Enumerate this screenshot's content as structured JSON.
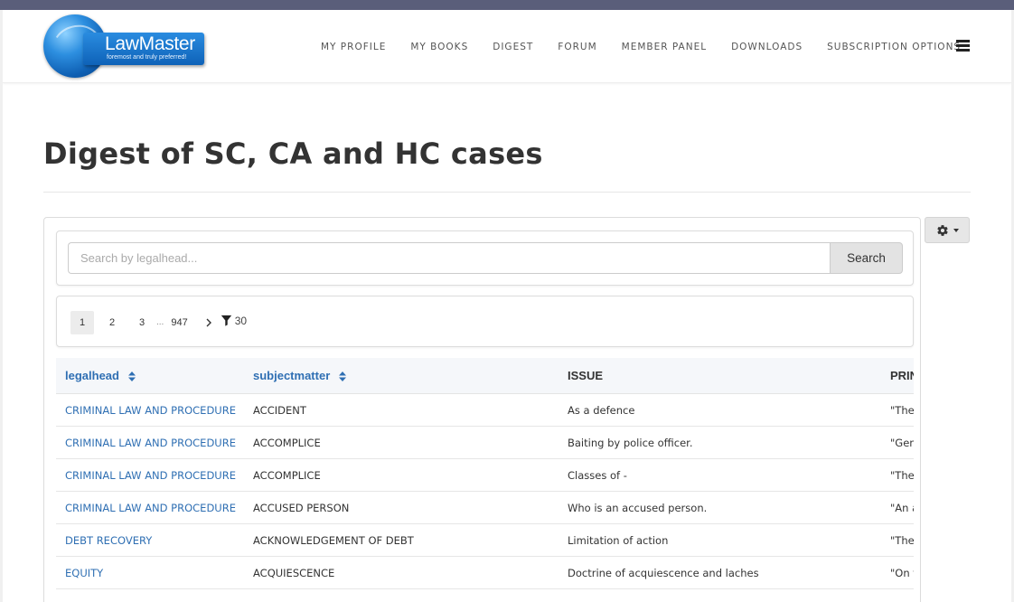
{
  "header": {
    "logo_title": "LawMaster",
    "logo_tagline": "foremost and truly preferred!",
    "nav": [
      {
        "label": "MY PROFILE"
      },
      {
        "label": "MY BOOKS"
      },
      {
        "label": "DIGEST"
      },
      {
        "label": "FORUM"
      },
      {
        "label": "MEMBER PANEL"
      },
      {
        "label": "DOWNLOADS"
      },
      {
        "label": "SUBSCRIPTION OPTIONS"
      }
    ],
    "menu_icon": "hamburger-icon"
  },
  "page": {
    "title": "Digest of SC, CA and HC cases",
    "settings_icon": "gear-icon"
  },
  "search": {
    "placeholder": "Search by legalhead...",
    "value": "",
    "button_label": "Search"
  },
  "pagination": {
    "pages": [
      "1",
      "2",
      "3"
    ],
    "active_page": "1",
    "ellipsis": "...",
    "last_page": "947",
    "next_icon": "chevron-right-icon",
    "filter_icon": "filter-icon",
    "filter_count": "30"
  },
  "table": {
    "columns": [
      {
        "label": "legalhead",
        "sortable": true
      },
      {
        "label": "subjectmatter",
        "sortable": true
      },
      {
        "label": "ISSUE",
        "sortable": false
      },
      {
        "label": "PRINCIPLE",
        "sortable": false
      }
    ],
    "rows": [
      {
        "legalhead": "CRIMINAL LAW AND PROCEDURE",
        "subjectmatter": "ACCIDENT",
        "issue": "As a defence",
        "principle": "\"The"
      },
      {
        "legalhead": "CRIMINAL LAW AND PROCEDURE",
        "subjectmatter": "ACCOMPLICE",
        "issue": "Baiting by police officer.",
        "principle": "\"Gen"
      },
      {
        "legalhead": "CRIMINAL LAW AND PROCEDURE",
        "subjectmatter": "ACCOMPLICE",
        "issue": "Classes of -",
        "principle": "\"The"
      },
      {
        "legalhead": "CRIMINAL LAW AND PROCEDURE",
        "subjectmatter": "ACCUSED PERSON",
        "issue": "Who is an accused person.",
        "principle": "\"An a"
      },
      {
        "legalhead": "DEBT RECOVERY",
        "subjectmatter": "ACKNOWLEDGEMENT OF DEBT",
        "issue": "Limitation of action",
        "principle": "\"The"
      },
      {
        "legalhead": "EQUITY",
        "subjectmatter": "ACQUIESCENCE",
        "issue": "Doctrine of acquiescence and laches",
        "principle": "\"On t"
      }
    ]
  },
  "colors": {
    "link": "#2f6fb3",
    "top_strip": "#5a5e7a",
    "logo_blue": "#0e62b8"
  }
}
